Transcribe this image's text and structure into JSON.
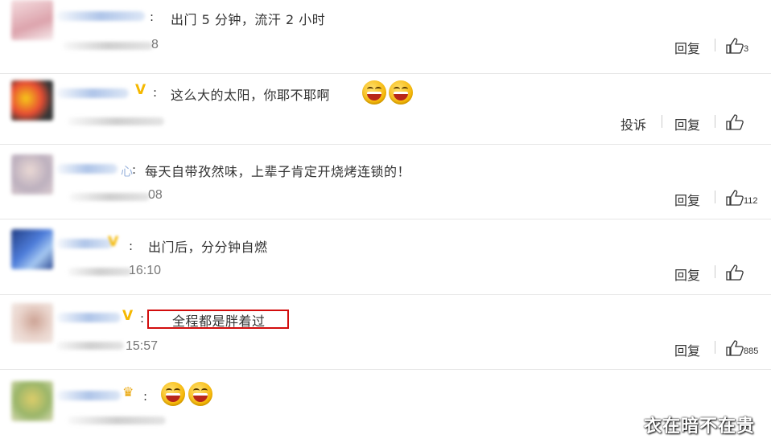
{
  "reply_label": "回复",
  "report_label": "投诉",
  "comments": [
    {
      "text": "出门 5 分钟，流汗 2 小时",
      "time_tail": "8",
      "likes": "3",
      "badge": ""
    },
    {
      "text": "这么大的太阳，你耶不耶啊",
      "time_tail": "",
      "likes": "",
      "badge": "V"
    },
    {
      "text": "每天自带孜然味，上辈子肯定开烧烤连锁的！",
      "time_tail": "08",
      "likes": "112",
      "badge": ""
    },
    {
      "text": "出门后，分分钟自燃",
      "time_tail": "16:10",
      "likes": "",
      "badge": ""
    },
    {
      "text": "全程都是胖着过",
      "time_tail": "15:57",
      "likes": "885",
      "badge": "V"
    },
    {
      "text": "",
      "time_tail": "",
      "likes": "",
      "badge": "crown"
    }
  ],
  "watermark": "衣在暗不在贵",
  "colors": {
    "vip_badge": "#f5b800",
    "highlight_box": "#d20d0d",
    "divider": "#e6e6e6"
  },
  "icons": [
    "thumb-up-icon",
    "laughing-emoji-icon",
    "crown-icon",
    "v-badge-icon"
  ]
}
